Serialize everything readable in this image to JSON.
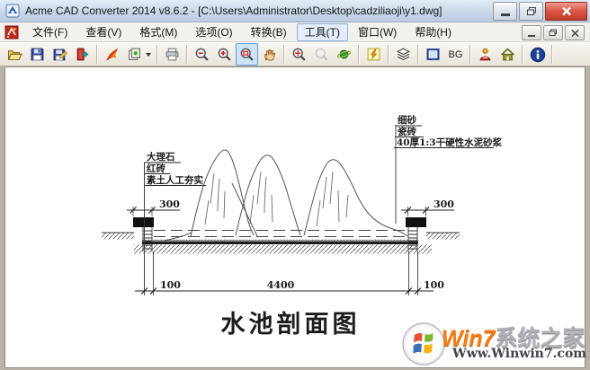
{
  "window": {
    "title": "Acme CAD Converter 2014 v8.6.2 - [C:\\Users\\Administrator\\Desktop\\cadziliaoji\\y1.dwg]"
  },
  "menu": {
    "items": [
      "文件(F)",
      "查看(V)",
      "格式(M)",
      "选项(O)",
      "转换(B)",
      "工具(T)",
      "窗口(W)",
      "帮助(H)"
    ],
    "active_item": "工具(T)"
  },
  "toolbar": {
    "bg_label": "BG",
    "selected_tool": "zoom-extents",
    "icons": [
      "open",
      "save",
      "save-as",
      "close-file",
      "convert",
      "batch-convert",
      "print",
      "zoom-out",
      "zoom-in",
      "zoom-extents",
      "pan",
      "zoom-window",
      "zoom-previous",
      "render",
      "flash",
      "layers",
      "background",
      "bg-color",
      "shx-fonts",
      "home",
      "about"
    ]
  },
  "drawing": {
    "labels_left": [
      "大理石",
      "红砖",
      "素土人工夯实"
    ],
    "labels_right": [
      "细砂",
      "瓷砖",
      "40厚1:3干硬性水泥砂浆"
    ],
    "dimensions": {
      "left_coping": "300",
      "right_coping": "300",
      "left_wall": "100",
      "pool_width": "4400",
      "right_wall": "100"
    },
    "title": "水池剖面图"
  },
  "watermark": {
    "brand_orange": "Win7",
    "brand_gray": "系统之家",
    "url": "Www.Winwin7.com"
  },
  "colors": {
    "titlebar": "#c6d5e7",
    "close_red": "#c03b28",
    "selection_blue": "#cde4f7",
    "drawing_ink": "#3c3c3c"
  }
}
